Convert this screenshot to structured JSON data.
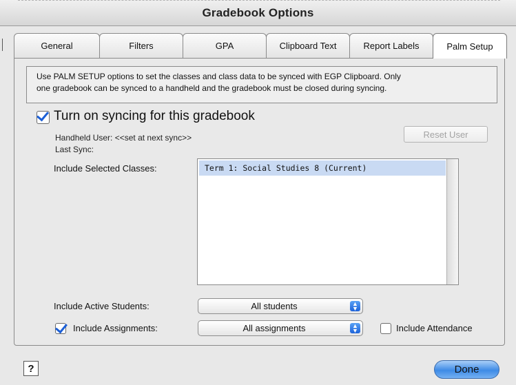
{
  "window": {
    "title": "Gradebook Options"
  },
  "tabs": [
    {
      "label": "General"
    },
    {
      "label": "Filters"
    },
    {
      "label": "GPA"
    },
    {
      "label": "Clipboard Text"
    },
    {
      "label": "Report Labels"
    },
    {
      "label": "Palm Setup",
      "active": true
    }
  ],
  "palm_setup": {
    "info_line1": "Use PALM SETUP options to set the classes and class data to be synced with EGP Clipboard. Only",
    "info_line2": "one gradebook can be synced to a handheld and the gradebook must be closed during syncing.",
    "sync_checkbox_label": "Turn on syncing for this gradebook",
    "sync_enabled": true,
    "handheld_user": "Handheld User: <<set at next sync>>",
    "last_sync": "Last Sync:",
    "reset_user_button": "Reset User",
    "include_classes_label": "Include Selected Classes:",
    "classes": [
      {
        "text": "Term 1: Social Studies 8 (Current)",
        "selected": true
      }
    ],
    "active_students_label": "Include Active Students:",
    "active_students_value": "All students",
    "include_assignments_label": "Include Assignments:",
    "include_assignments_checked": true,
    "assignments_value": "All assignments",
    "include_attendance_label": "Include Attendance",
    "include_attendance_checked": false
  },
  "footer": {
    "help_label": "?",
    "done_label": "Done"
  },
  "colors": {
    "accent": "#1b5fd6",
    "selection": "#c9daf3",
    "done_button": "#3e8be6"
  }
}
